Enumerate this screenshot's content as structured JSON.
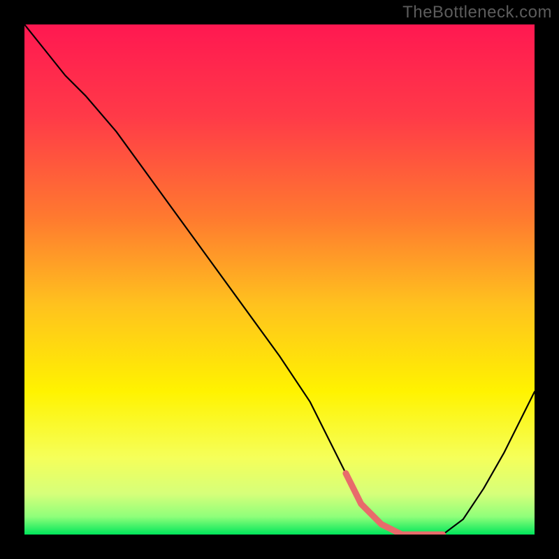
{
  "watermark": "TheBottleneck.com",
  "colors": {
    "frame": "#000000",
    "watermark": "#5c5c5c",
    "gradient_stops": [
      {
        "offset": 0.0,
        "color": "#ff1851"
      },
      {
        "offset": 0.18,
        "color": "#ff3a48"
      },
      {
        "offset": 0.38,
        "color": "#ff7a2f"
      },
      {
        "offset": 0.55,
        "color": "#ffc21e"
      },
      {
        "offset": 0.72,
        "color": "#fff300"
      },
      {
        "offset": 0.85,
        "color": "#f5ff5a"
      },
      {
        "offset": 0.92,
        "color": "#d6ff7a"
      },
      {
        "offset": 0.965,
        "color": "#8fff7a"
      },
      {
        "offset": 1.0,
        "color": "#00e65b"
      }
    ],
    "curve": "#000000",
    "marker": "#e86b6b"
  },
  "chart_data": {
    "type": "line",
    "title": "",
    "xlabel": "",
    "ylabel": "",
    "xlim": [
      0,
      100
    ],
    "ylim": [
      0,
      100
    ],
    "grid": false,
    "legend": false,
    "series": [
      {
        "name": "bottleneck_curve",
        "x": [
          0,
          4,
          8,
          12,
          18,
          26,
          34,
          42,
          50,
          56,
          60,
          63,
          66,
          70,
          74,
          78,
          82,
          86,
          90,
          94,
          98,
          100
        ],
        "values": [
          100,
          95,
          90,
          86,
          79,
          68,
          57,
          46,
          35,
          26,
          18,
          12,
          6,
          2,
          0,
          0,
          0,
          3,
          9,
          16,
          24,
          28
        ]
      }
    ],
    "markers": [
      {
        "name": "optimal_range",
        "x": [
          63,
          66,
          70,
          74,
          78,
          82
        ],
        "values": [
          12,
          6,
          2,
          0,
          0,
          0
        ]
      }
    ]
  }
}
